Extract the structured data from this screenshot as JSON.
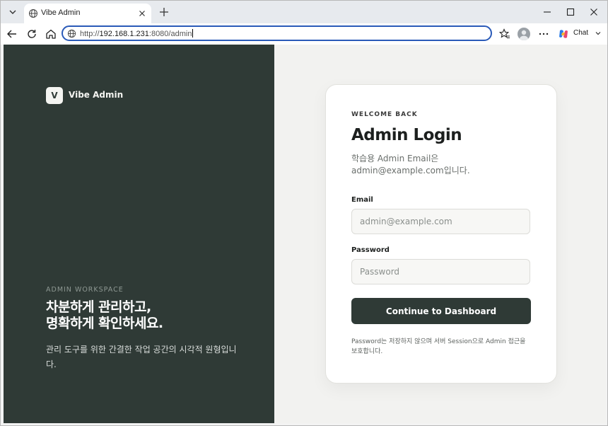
{
  "browser": {
    "tab_title": "Vibe Admin",
    "address_scheme": "http://",
    "address_host": "192.168.1.231",
    "address_rest": ":8080/admin",
    "chat_label": "Chat"
  },
  "sidebar": {
    "logo_letter": "V",
    "brand_name": "Vibe Admin",
    "eyebrow": "ADMIN WORKSPACE",
    "headline_line1": "차분하게 관리하고,",
    "headline_line2": "명확하게 확인하세요.",
    "description": "관리 도구를 위한 간결한 작업 공간의 시각적 원형입니다."
  },
  "login": {
    "eyebrow": "WELCOME BACK",
    "title": "Admin Login",
    "subtitle": "학습용 Admin Email은 admin@example.com입니다.",
    "email_label": "Email",
    "email_placeholder": "admin@example.com",
    "password_label": "Password",
    "password_placeholder": "Password",
    "submit_label": "Continue to Dashboard",
    "note": "Password는 저장하지 않으며 서버 Session으로 Admin 접근을 보호합니다."
  },
  "colors": {
    "sidebar_bg": "#2f3a36",
    "page_bg": "#f2f2f0",
    "primary_button": "#2f3a36",
    "address_focus": "#2a5ab8"
  },
  "icons": [
    "tab-list-icon",
    "globe-icon",
    "close-icon",
    "plus-icon",
    "minimize-icon",
    "maximize-icon",
    "window-close-icon",
    "back-icon",
    "refresh-icon",
    "home-icon",
    "favorites-icon",
    "profile-icon",
    "more-icon",
    "copilot-icon",
    "chevron-down-icon"
  ]
}
